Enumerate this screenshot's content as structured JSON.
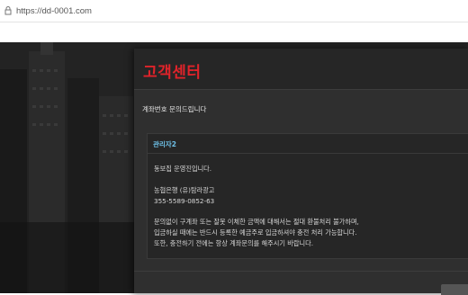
{
  "browser": {
    "url": "https://dd-0001.com"
  },
  "modal": {
    "title": "고객센터",
    "subtitle": "계좌번호 문의드립니다",
    "message": {
      "author": "관리자2",
      "lines": [
        "동보집 운영진입니다.",
        "농협은행 (유)탐라광고",
        "355-5589-0852-63",
        "문의없이 구계좌 또는 잘못 이체한 금액에 대해서는 절대 환불처리 불가하며,",
        "입금하실 때에는 반드시 등록한 예금주로 입금하셔야 충전 처리 가능합니다.",
        "또한, 충전하기 전에는 항상 계좌문의를 해주시기 바랍니다."
      ]
    }
  },
  "colors": {
    "title_red": "#e0232a",
    "author_blue": "#6ec1e8",
    "modal_bg": "#2f2f2f"
  },
  "icons": {
    "url_icon": "site-info-icon"
  }
}
